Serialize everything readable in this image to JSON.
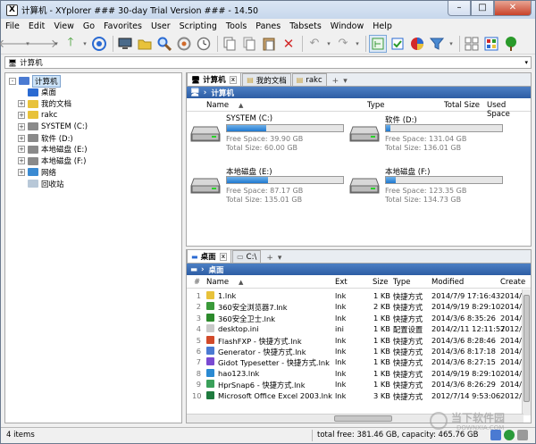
{
  "window": {
    "title": "计算机 - XYplorer ### 30-day Trial Version ### - 14.50",
    "app_icon_text": "X"
  },
  "menu": [
    "File",
    "Edit",
    "View",
    "Go",
    "Favorites",
    "User",
    "Scripting",
    "Tools",
    "Panes",
    "Tabsets",
    "Window",
    "Help"
  ],
  "address": {
    "value": "计算机"
  },
  "tree": [
    {
      "label": "计算机",
      "indent": 0,
      "toggle": "-",
      "icon": "computer",
      "selected": true
    },
    {
      "label": "桌面",
      "indent": 1,
      "toggle": "",
      "icon": "desktop"
    },
    {
      "label": "我的文档",
      "indent": 1,
      "toggle": "+",
      "icon": "docs"
    },
    {
      "label": "rakc",
      "indent": 1,
      "toggle": "+",
      "icon": "user"
    },
    {
      "label": "SYSTEM (C:)",
      "indent": 1,
      "toggle": "+",
      "icon": "drive"
    },
    {
      "label": "软件 (D:)",
      "indent": 1,
      "toggle": "+",
      "icon": "drive"
    },
    {
      "label": "本地磁盘 (E:)",
      "indent": 1,
      "toggle": "+",
      "icon": "drive"
    },
    {
      "label": "本地磁盘 (F:)",
      "indent": 1,
      "toggle": "+",
      "icon": "drive"
    },
    {
      "label": "网络",
      "indent": 1,
      "toggle": "+",
      "icon": "network"
    },
    {
      "label": "回收站",
      "indent": 1,
      "toggle": "",
      "icon": "recycle"
    }
  ],
  "pane1": {
    "tabs": [
      {
        "label": "计算机",
        "active": true,
        "close": "x"
      },
      {
        "label": "我的文档",
        "active": false
      },
      {
        "label": "rakc",
        "active": false
      }
    ],
    "tab_add": "+",
    "tab_menu": "▾",
    "breadcrumb": "计算机",
    "columns": [
      "Name",
      "Type",
      "Total Size",
      "Used Space"
    ],
    "drives": [
      {
        "name": "SYSTEM (C:)",
        "free": "Free Space: 39.90 GB",
        "total": "Total Size: 60.00 GB",
        "used_fraction": 0.335
      },
      {
        "name": "软件 (D:)",
        "free": "Free Space: 131.04 GB",
        "total": "Total Size: 136.01 GB",
        "used_fraction": 0.04
      },
      {
        "name": "本地磁盘 (E:)",
        "free": "Free Space: 87.17 GB",
        "total": "Total Size: 135.01 GB",
        "used_fraction": 0.355
      },
      {
        "name": "本地磁盘 (F:)",
        "free": "Free Space: 123.35 GB",
        "total": "Total Size: 134.73 GB",
        "used_fraction": 0.085
      }
    ]
  },
  "pane2": {
    "tabs": [
      {
        "label": "桌面",
        "active": true,
        "close": "x"
      },
      {
        "label": "C:\\",
        "active": false
      }
    ],
    "tab_add": "+",
    "tab_menu": "▾",
    "breadcrumb": "桌面",
    "columns": [
      "#",
      "Name",
      "Ext",
      "Size",
      "Type",
      "Modified",
      "Create"
    ],
    "files": [
      {
        "n": "1",
        "name": "1.lnk",
        "ext": "lnk",
        "size": "1 KB",
        "type": "快捷方式",
        "modified": "2014/7/9 17:16:43",
        "created": "2014/",
        "icon": "#e8c23a"
      },
      {
        "n": "2",
        "name": "360安全浏览器7.lnk",
        "ext": "lnk",
        "size": "2 KB",
        "type": "快捷方式",
        "modified": "2014/9/19 8:29:10",
        "created": "2014/",
        "icon": "#3a9a3a"
      },
      {
        "n": "3",
        "name": "360安全卫士.lnk",
        "ext": "lnk",
        "size": "1 KB",
        "type": "快捷方式",
        "modified": "2014/3/6 8:35:26",
        "created": "2014/",
        "icon": "#2c8a2c"
      },
      {
        "n": "4",
        "name": "desktop.ini",
        "ext": "ini",
        "size": "1 KB",
        "type": "配置设置",
        "modified": "2014/2/11 12:11:57",
        "created": "2012/",
        "icon": "#c9c9c9"
      },
      {
        "n": "5",
        "name": "FlashFXP - 快捷方式.lnk",
        "ext": "lnk",
        "size": "1 KB",
        "type": "快捷方式",
        "modified": "2014/3/6 8:28:46",
        "created": "2014/",
        "icon": "#d24a2a"
      },
      {
        "n": "6",
        "name": "Generator - 快捷方式.lnk",
        "ext": "lnk",
        "size": "1 KB",
        "type": "快捷方式",
        "modified": "2014/3/6 8:17:18",
        "created": "2014/",
        "icon": "#4a7ad2"
      },
      {
        "n": "7",
        "name": "Gidot Typesetter - 快捷方式.lnk",
        "ext": "lnk",
        "size": "1 KB",
        "type": "快捷方式",
        "modified": "2014/3/6 8:27:15",
        "created": "2014/",
        "icon": "#7a4ad2"
      },
      {
        "n": "8",
        "name": "hao123.lnk",
        "ext": "lnk",
        "size": "1 KB",
        "type": "快捷方式",
        "modified": "2014/9/19 8:29:10",
        "created": "2014/",
        "icon": "#2a8ad2"
      },
      {
        "n": "9",
        "name": "HprSnap6 - 快捷方式.lnk",
        "ext": "lnk",
        "size": "1 KB",
        "type": "快捷方式",
        "modified": "2014/3/6 8:26:29",
        "created": "2014/",
        "icon": "#3aa05a"
      },
      {
        "n": "10",
        "name": "Microsoft Office Excel 2003.lnk",
        "ext": "lnk",
        "size": "3 KB",
        "type": "快捷方式",
        "modified": "2012/7/14 9:53:06",
        "created": "2012/",
        "icon": "#1e7a3e"
      }
    ]
  },
  "status": {
    "items": "4 items",
    "free": "total free: 381.46 GB, capacity: 465.76 GB"
  },
  "watermark": {
    "line1": "当下软件园",
    "line2": "DOWNXIA.COM"
  }
}
